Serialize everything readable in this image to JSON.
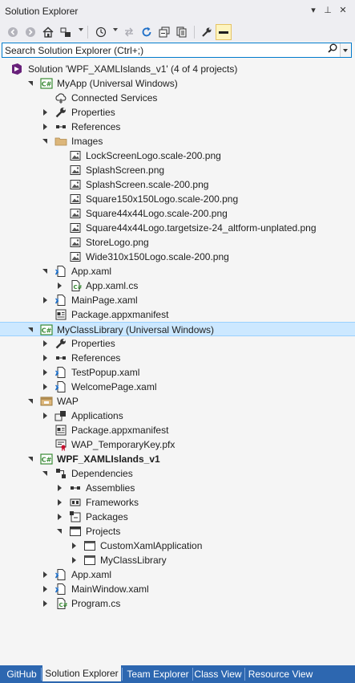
{
  "window": {
    "title": "Solution Explorer",
    "buttons": [
      "▾",
      "⊥",
      "✕"
    ]
  },
  "search": {
    "placeholder": "Search Solution Explorer (Ctrl+;)"
  },
  "tree": [
    {
      "label": "Solution 'WPF_XAMLIslands_v1' (4 of 4 projects)",
      "icon": "solution-icon",
      "level": 0,
      "expander": "none"
    },
    {
      "label": "MyApp (Universal Windows)",
      "icon": "csharp-project-icon",
      "level": 1,
      "expander": "open"
    },
    {
      "label": "Connected Services",
      "icon": "connected-services-icon",
      "level": 2,
      "expander": "none"
    },
    {
      "label": "Properties",
      "icon": "wrench-icon",
      "level": 2,
      "expander": "closed"
    },
    {
      "label": "References",
      "icon": "references-icon",
      "level": 2,
      "expander": "closed"
    },
    {
      "label": "Images",
      "icon": "folder-icon",
      "level": 2,
      "expander": "open"
    },
    {
      "label": "LockScreenLogo.scale-200.png",
      "icon": "image-file-icon",
      "level": 3,
      "expander": "none"
    },
    {
      "label": "SplashScreen.png",
      "icon": "image-file-icon",
      "level": 3,
      "expander": "none"
    },
    {
      "label": "SplashScreen.scale-200.png",
      "icon": "image-file-icon",
      "level": 3,
      "expander": "none"
    },
    {
      "label": "Square150x150Logo.scale-200.png",
      "icon": "image-file-icon",
      "level": 3,
      "expander": "none"
    },
    {
      "label": "Square44x44Logo.scale-200.png",
      "icon": "image-file-icon",
      "level": 3,
      "expander": "none"
    },
    {
      "label": "Square44x44Logo.targetsize-24_altform-unplated.png",
      "icon": "image-file-icon",
      "level": 3,
      "expander": "none"
    },
    {
      "label": "StoreLogo.png",
      "icon": "image-file-icon",
      "level": 3,
      "expander": "none"
    },
    {
      "label": "Wide310x150Logo.scale-200.png",
      "icon": "image-file-icon",
      "level": 3,
      "expander": "none"
    },
    {
      "label": "App.xaml",
      "icon": "xaml-file-icon",
      "level": 2,
      "expander": "open"
    },
    {
      "label": "App.xaml.cs",
      "icon": "csharp-file-icon",
      "level": 3,
      "expander": "closed"
    },
    {
      "label": "MainPage.xaml",
      "icon": "xaml-file-icon",
      "level": 2,
      "expander": "closed"
    },
    {
      "label": "Package.appxmanifest",
      "icon": "manifest-icon",
      "level": 2,
      "expander": "none"
    },
    {
      "label": "MyClassLibrary (Universal Windows)",
      "icon": "csharp-project-icon",
      "level": 1,
      "expander": "open",
      "selected": true
    },
    {
      "label": "Properties",
      "icon": "wrench-icon",
      "level": 2,
      "expander": "closed"
    },
    {
      "label": "References",
      "icon": "references-icon",
      "level": 2,
      "expander": "closed"
    },
    {
      "label": "TestPopup.xaml",
      "icon": "xaml-file-icon",
      "level": 2,
      "expander": "closed"
    },
    {
      "label": "WelcomePage.xaml",
      "icon": "xaml-file-icon",
      "level": 2,
      "expander": "closed"
    },
    {
      "label": "WAP",
      "icon": "wap-project-icon",
      "level": 1,
      "expander": "open"
    },
    {
      "label": "Applications",
      "icon": "applications-icon",
      "level": 2,
      "expander": "closed"
    },
    {
      "label": "Package.appxmanifest",
      "icon": "manifest-icon",
      "level": 2,
      "expander": "none"
    },
    {
      "label": "WAP_TemporaryKey.pfx",
      "icon": "certificate-icon",
      "level": 2,
      "expander": "none"
    },
    {
      "label": "WPF_XAMLIslands_v1",
      "icon": "csharp-project-icon",
      "level": 1,
      "expander": "open",
      "bold": true
    },
    {
      "label": "Dependencies",
      "icon": "dependencies-icon",
      "level": 2,
      "expander": "open"
    },
    {
      "label": "Assemblies",
      "icon": "references-icon",
      "level": 3,
      "expander": "closed"
    },
    {
      "label": "Frameworks",
      "icon": "framework-icon",
      "level": 3,
      "expander": "closed"
    },
    {
      "label": "Packages",
      "icon": "package-icon",
      "level": 3,
      "expander": "closed"
    },
    {
      "label": "Projects",
      "icon": "projects-icon",
      "level": 3,
      "expander": "open"
    },
    {
      "label": "CustomXamlApplication",
      "icon": "project-ref-icon",
      "level": 4,
      "expander": "closed"
    },
    {
      "label": "MyClassLibrary",
      "icon": "project-ref-icon",
      "level": 4,
      "expander": "closed"
    },
    {
      "label": "App.xaml",
      "icon": "xaml-file-icon",
      "level": 2,
      "expander": "closed"
    },
    {
      "label": "MainWindow.xaml",
      "icon": "xaml-file-icon",
      "level": 2,
      "expander": "closed"
    },
    {
      "label": "Program.cs",
      "icon": "csharp-file-icon",
      "level": 2,
      "expander": "closed"
    }
  ],
  "tabs": [
    {
      "label": "GitHub",
      "active": false
    },
    {
      "label": "Solution Explorer",
      "active": true
    },
    {
      "label": "Team Explorer",
      "active": false
    },
    {
      "label": "Class View",
      "active": false
    },
    {
      "label": "Resource View",
      "active": false
    }
  ],
  "colors": {
    "selection": "#cce8ff",
    "tab_bar": "#2d67b0",
    "csharp_green": "#388a34",
    "accent": "#007acc"
  }
}
